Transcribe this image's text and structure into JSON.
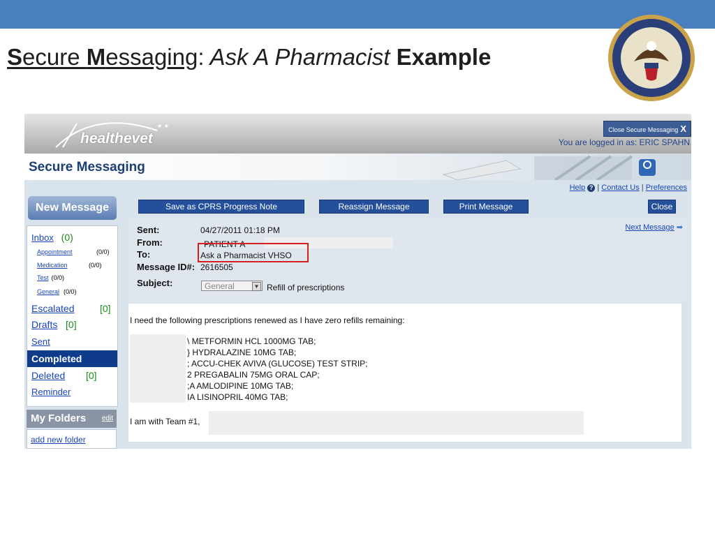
{
  "slide": {
    "title_part1_initial": "S",
    "title_part1_rest": "ecure ",
    "title_part2_initial": "M",
    "title_part2_rest": "essaging",
    "title_colon": ":",
    "title_italic": " Ask A Pharmacist ",
    "title_bold": "Example"
  },
  "header": {
    "logo_text": "healthevet",
    "close_label": "Close Secure Messaging",
    "close_x": "X",
    "logged_in": "You are logged in as: ERIC SPAHN"
  },
  "app": {
    "title": "Secure Messaging"
  },
  "toplinks": {
    "help": "Help",
    "help_icon": "?",
    "sep1": " | ",
    "contact": "Contact Us",
    "sep2": " | ",
    "preferences": "Preferences"
  },
  "sidebar": {
    "new_message": "New Message",
    "inbox": {
      "label": "Inbox",
      "count": "(0)"
    },
    "inbox_sub": [
      {
        "label": "Appointment",
        "count": "(0/0)"
      },
      {
        "label": "Medication",
        "count": "(0/0)"
      },
      {
        "label": "Test",
        "count": "(0/0)"
      },
      {
        "label": "General",
        "count": "(0/0)"
      }
    ],
    "escalated": {
      "label": "Escalated",
      "count": "[0]"
    },
    "drafts": {
      "label": "Drafts",
      "count": "[0]"
    },
    "sent": "Sent",
    "completed": "Completed",
    "deleted": {
      "label": "Deleted",
      "count": "[0]"
    },
    "reminder": "Reminder",
    "my_folders": "My Folders",
    "edit": "edit",
    "add_new_folder": "add new folder"
  },
  "toolbar": {
    "save_cprs": "Save as CPRS Progress Note",
    "reassign": "Reassign Message",
    "print": "Print Message",
    "close": "Close"
  },
  "message": {
    "sent_label": "Sent:",
    "sent_value": "04/27/2011 01:18 PM",
    "from_label": "From:",
    "from_value": "PATIENT A",
    "to_label": "To:",
    "to_value": "Ask a Pharmacist VHSO",
    "id_label": "Message ID#:",
    "id_value": "2616505",
    "subject_label": "Subject:",
    "subject_select": "General",
    "subject_value": "Refill of prescriptions",
    "next_message": "Next Message",
    "body_intro": "I need the following prescriptions renewed as I have zero refills remaining:",
    "prescriptions": [
      "\\ METFORMIN HCL 1000MG TAB;",
      "} HYDRALAZINE 10MG TAB;",
      "; ACCU-CHEK AVIVA (GLUCOSE) TEST STRIP;",
      "2 PREGABALIN 75MG ORAL CAP;",
      ";A AMLODIPINE 10MG TAB;",
      "IA LISINOPRIL 40MG TAB;"
    ],
    "closing": "I am with Team #1,"
  },
  "colors": {
    "top_band": "#4a7fbf",
    "nav_dark": "#0e3b8a",
    "button": "#244f9b",
    "highlight": "#d62020"
  }
}
